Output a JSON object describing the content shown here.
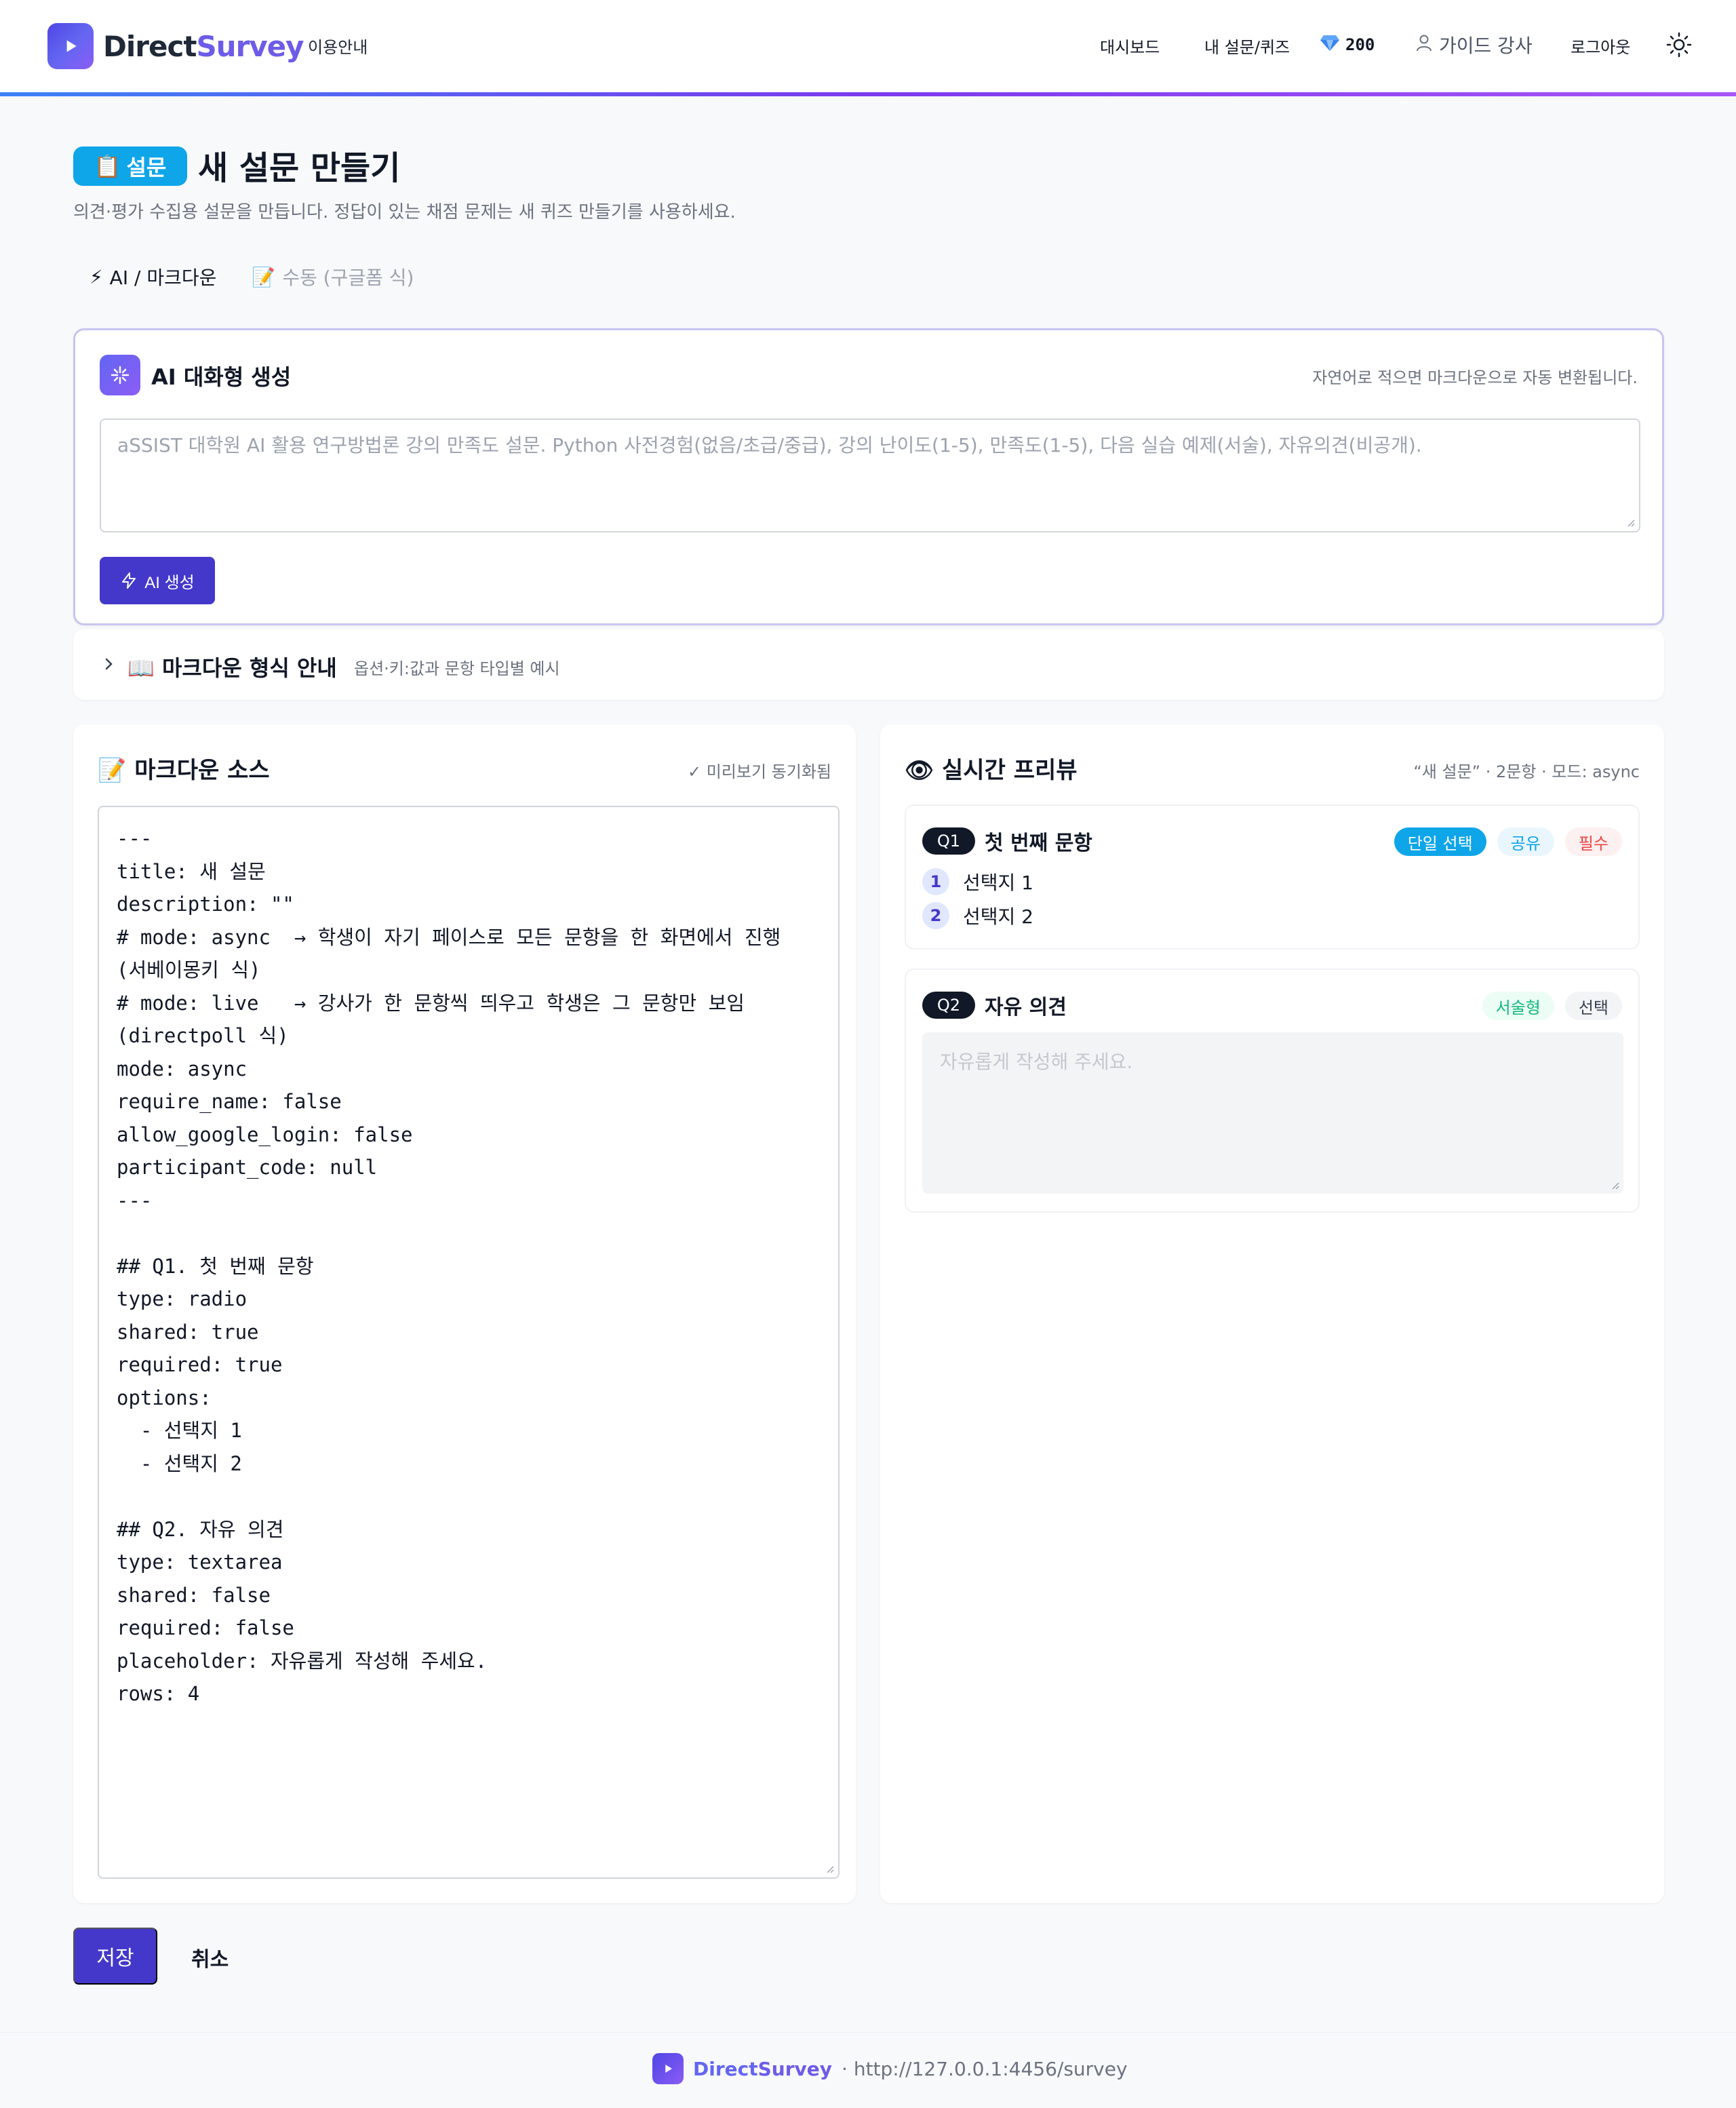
{
  "header": {
    "brand_a": "Direct",
    "brand_b": "Survey",
    "nav_guide": "이용안내",
    "nav_dashboard": "대시보드",
    "nav_my": "내 설문/퀴즈",
    "credits": "200",
    "user_name": "가이드 강사",
    "logout": "로그아웃",
    "accent_gradient": [
      "#3b82f6",
      "#7c3aed",
      "#a855f7"
    ]
  },
  "title": {
    "badge": "설문",
    "badge_emoji": "📋",
    "heading": "새 설문 만들기",
    "subtitle": "의견·평가 수집용 설문을 만듭니다. 정답이 있는 채점 문제는 새 퀴즈 만들기를 사용하세요."
  },
  "mode_tabs": [
    {
      "icon": "⚡",
      "label": "AI / 마크다운",
      "active": true
    },
    {
      "icon": "📝",
      "label": "수동 (구글폼 식)",
      "active": false
    }
  ],
  "ai_card": {
    "title": "AI 대화형 생성",
    "hint": "자연어로 적으면 마크다운으로 자동 변환됩니다.",
    "placeholder": "aSSIST 대학원 AI 활용 연구방법론 강의 만족도 설문. Python 사전경험(없음/초급/중급), 강의 난이도(1-5), 만족도(1-5), 다음 실습 예제(서술), 자유의견(비공개).",
    "button": "AI 생성"
  },
  "md_guide": {
    "icon": "📖",
    "title": "마크다운 형식 안내",
    "sub": "옵션·키:값과 문항 타입별 예시"
  },
  "source": {
    "icon": "📝",
    "title": "마크다운 소스",
    "sync": "✓ 미리보기 동기화됨",
    "text": "---\ntitle: 새 설문\ndescription: \"\"\n# mode: async  → 학생이 자기 페이스로 모든 문항을 한 화면에서 진행 (서베이몽키 식)\n# mode: live   → 강사가 한 문항씩 띄우고 학생은 그 문항만 보임 (directpoll 식)\nmode: async\nrequire_name: false\nallow_google_login: false\nparticipant_code: null\n---\n\n## Q1. 첫 번째 문항\ntype: radio\nshared: true\nrequired: true\noptions:\n  - 선택지 1\n  - 선택지 2\n\n## Q2. 자유 의견\ntype: textarea\nshared: false\nrequired: false\nplaceholder: 자유롭게 작성해 주세요.\nrows: 4"
  },
  "preview": {
    "icon": "👁",
    "title": "실시간 프리뷰",
    "meta": "“새 설문” · 2문항 · 모드: async",
    "q1": {
      "num": "Q1",
      "title": "첫 번째 문항",
      "tags": [
        "단일 선택",
        "공유",
        "필수"
      ],
      "options": [
        {
          "n": "1",
          "label": "선택지 1"
        },
        {
          "n": "2",
          "label": "선택지 2"
        }
      ]
    },
    "q2": {
      "num": "Q2",
      "title": "자유 의견",
      "tags": [
        "서술형",
        "선택"
      ],
      "placeholder": "자유롭게 작성해 주세요."
    }
  },
  "actions": {
    "save": "저장",
    "cancel": "취소"
  },
  "footer": {
    "brand_a": "Direct",
    "brand_b": "Survey",
    "url": "· http://127.0.0.1:4456/survey"
  }
}
